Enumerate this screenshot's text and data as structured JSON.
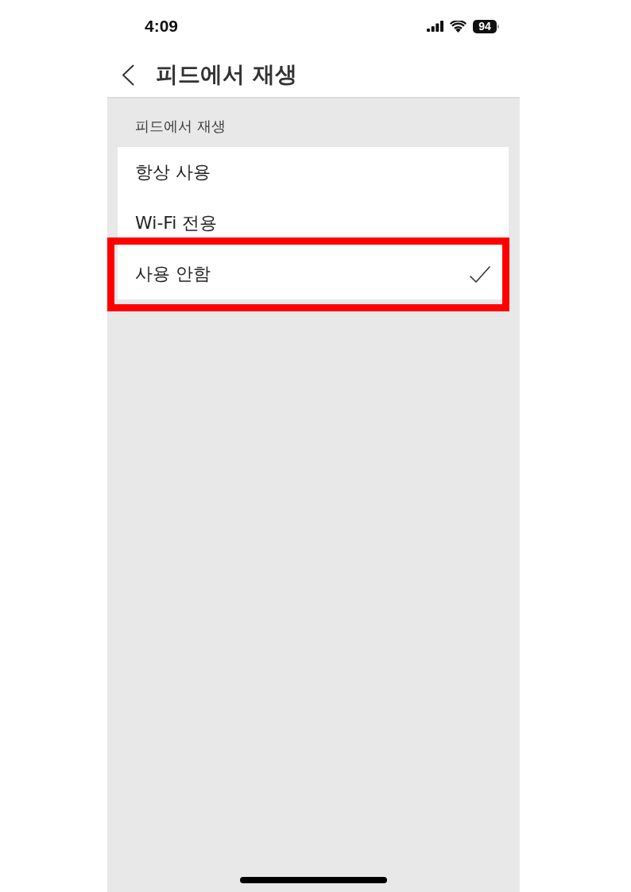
{
  "status_bar": {
    "time": "4:09",
    "battery": "94"
  },
  "header": {
    "title": "피드에서 재생"
  },
  "section": {
    "label": "피드에서 재생",
    "options": [
      {
        "label": "항상 사용",
        "selected": false,
        "highlighted": false
      },
      {
        "label": "Wi-Fi 전용",
        "selected": false,
        "highlighted": false
      },
      {
        "label": "사용 안함",
        "selected": true,
        "highlighted": true
      }
    ]
  }
}
